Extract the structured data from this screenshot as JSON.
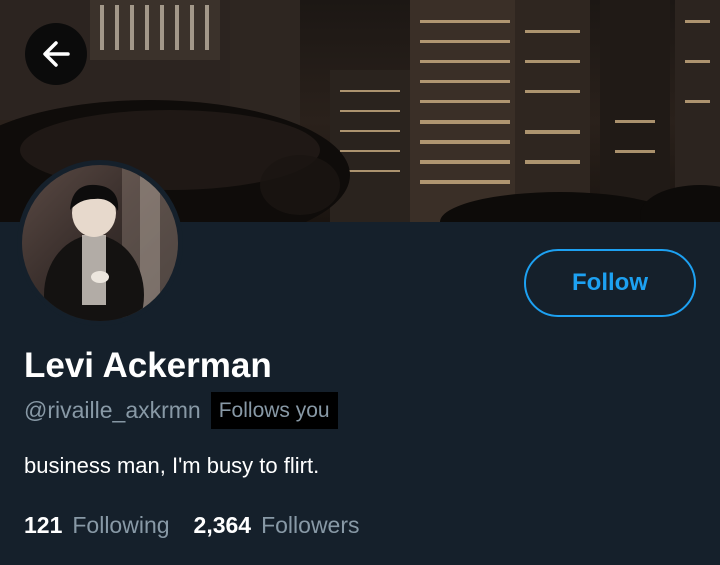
{
  "profile": {
    "name": "Levi Ackerman",
    "handle": "@rivaille_axkrmn",
    "follows_you": "Follows you",
    "bio": "business man, I'm busy to flirt.",
    "following_count": "121",
    "following_label": "Following",
    "followers_count": "2,364",
    "followers_label": "Followers"
  },
  "actions": {
    "follow_label": "Follow"
  },
  "icons": {
    "back": "arrow-left-icon"
  },
  "colors": {
    "background": "#15202b",
    "accent": "#1da1f2",
    "secondary_text": "#8899a6",
    "primary_text": "#ffffff"
  }
}
